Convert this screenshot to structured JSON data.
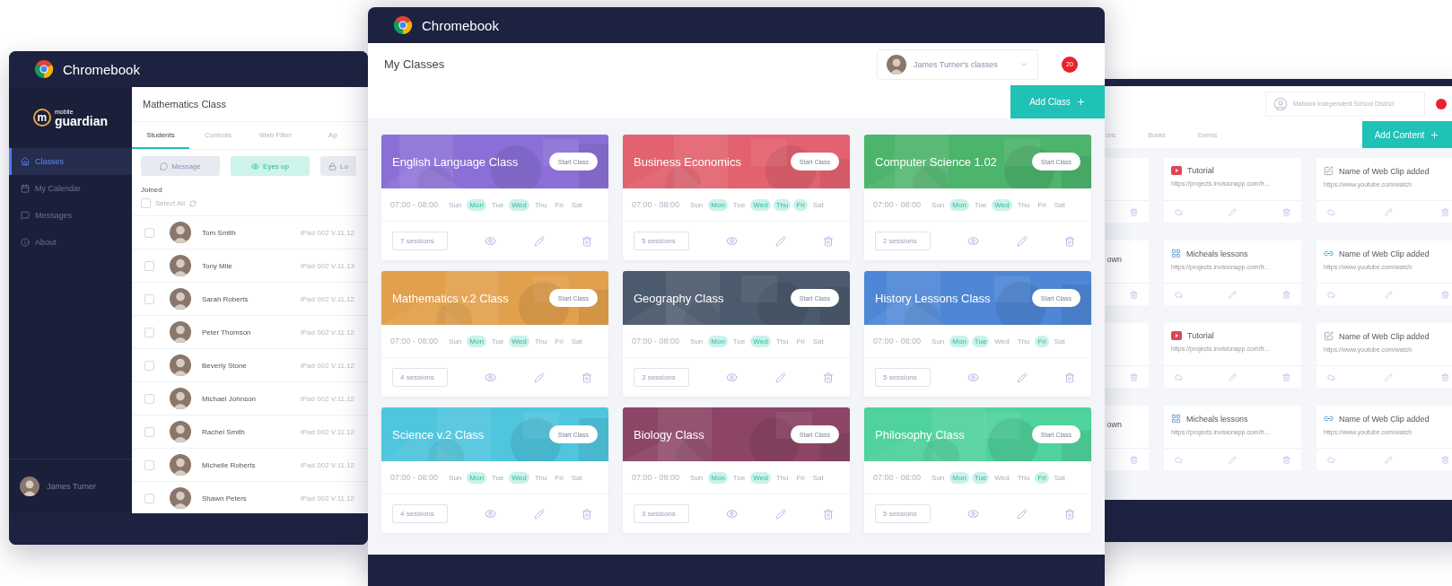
{
  "left_window": {
    "title": "Chromebook",
    "logo": {
      "mark": "m",
      "top": "mobile",
      "bottom": "guardian"
    },
    "nav": [
      {
        "label": "Classes",
        "selected": true
      },
      {
        "label": "My Calendar",
        "selected": false
      },
      {
        "label": "Messages",
        "selected": false
      },
      {
        "label": "About",
        "selected": false
      }
    ],
    "user": "James Turner",
    "heading": "Mathematics Class",
    "tabs": [
      {
        "label": "Students",
        "selected": true
      },
      {
        "label": "Controls",
        "selected": false
      },
      {
        "label": "Web Filter",
        "selected": false
      },
      {
        "label": "Ap",
        "selected": false
      }
    ],
    "actions": [
      {
        "label": "Message",
        "kind": "plain"
      },
      {
        "label": "Eyes up",
        "kind": "accent"
      },
      {
        "label": "Lo",
        "kind": "plain"
      }
    ],
    "group": "Joined",
    "select_all": {
      "label": "Select All",
      "checked": false
    },
    "students": [
      {
        "name": "Tom Smith",
        "device": "iPad 002 V.11.12",
        "checked": false
      },
      {
        "name": "Tony Mile",
        "device": "iPad 002 V.11.13",
        "checked": false
      },
      {
        "name": "Sarah Roberts",
        "device": "iPad 002 V.11.12",
        "checked": false
      },
      {
        "name": "Peter Thomson",
        "device": "iPad 002 V.11.12",
        "checked": false
      },
      {
        "name": "Beverly Stone",
        "device": "iPad 002 V.11.12",
        "checked": false
      },
      {
        "name": "Michael Johnson",
        "device": "iPad 002 V.11.12",
        "checked": false
      },
      {
        "name": "Rachel Smith",
        "device": "iPad 002 V.11.12",
        "checked": false
      },
      {
        "name": "Michelle Roberts",
        "device": "iPad 002 V.11.12",
        "checked": false
      },
      {
        "name": "Shawn Peters",
        "device": "iPad 002 V.11.12",
        "checked": false
      }
    ]
  },
  "center_window": {
    "title": "Chromebook",
    "heading": "My Classes",
    "class_picker": "James Turner's classes",
    "badge": "20",
    "add_button": "Add Class",
    "classes": [
      {
        "name": "English Language Class",
        "color": "#8b6fd6",
        "action": "Start Class",
        "time": "07:00 - 08:00",
        "sessions": "7 sessions",
        "days": [
          {
            "label": "Sun",
            "selected": false
          },
          {
            "label": "Mon",
            "selected": true
          },
          {
            "label": "Tue",
            "selected": false
          },
          {
            "label": "Wed",
            "selected": true
          },
          {
            "label": "Thu",
            "selected": false
          },
          {
            "label": "Fri",
            "selected": false
          },
          {
            "label": "Sat",
            "selected": false
          }
        ]
      },
      {
        "name": "Business Economics",
        "color": "#e2626f",
        "action": "Start Class",
        "time": "07:00 - 08:00",
        "sessions": "5 sessions",
        "days": [
          {
            "label": "Sun",
            "selected": false
          },
          {
            "label": "Mon",
            "selected": true
          },
          {
            "label": "Tue",
            "selected": false
          },
          {
            "label": "Wed",
            "selected": true
          },
          {
            "label": "Thu",
            "selected": true
          },
          {
            "label": "Fri",
            "selected": true
          },
          {
            "label": "Sat",
            "selected": false
          }
        ]
      },
      {
        "name": "Computer Science 1.02",
        "color": "#4db46c",
        "action": "Start Class",
        "time": "07:00 - 08:00",
        "sessions": "2 sessions",
        "days": [
          {
            "label": "Sun",
            "selected": false
          },
          {
            "label": "Mon",
            "selected": true
          },
          {
            "label": "Tue",
            "selected": false
          },
          {
            "label": "Wed",
            "selected": true
          },
          {
            "label": "Thu",
            "selected": false
          },
          {
            "label": "Fri",
            "selected": false
          },
          {
            "label": "Sat",
            "selected": false
          }
        ]
      },
      {
        "name": "Mathematics v.2 Class",
        "color": "#e3a04c",
        "action": "Start Class",
        "time": "07:00 - 08:00",
        "sessions": "4 sessions",
        "days": [
          {
            "label": "Sun",
            "selected": false
          },
          {
            "label": "Mon",
            "selected": true
          },
          {
            "label": "Tue",
            "selected": false
          },
          {
            "label": "Wed",
            "selected": true
          },
          {
            "label": "Thu",
            "selected": false
          },
          {
            "label": "Fri",
            "selected": false
          },
          {
            "label": "Sat",
            "selected": false
          }
        ]
      },
      {
        "name": "Geography Class",
        "color": "#4b5a6d",
        "action": "Start Class",
        "time": "07:00 - 08:00",
        "sessions": "3 sessions",
        "days": [
          {
            "label": "Sun",
            "selected": false
          },
          {
            "label": "Mon",
            "selected": true
          },
          {
            "label": "Tue",
            "selected": false
          },
          {
            "label": "Wed",
            "selected": true
          },
          {
            "label": "Thu",
            "selected": false
          },
          {
            "label": "Fri",
            "selected": false
          },
          {
            "label": "Sat",
            "selected": false
          }
        ]
      },
      {
        "name": "History Lessons Class",
        "color": "#4f87d6",
        "action": "Start Class",
        "time": "07:00 - 08:00",
        "sessions": "5 sessions",
        "days": [
          {
            "label": "Sun",
            "selected": false
          },
          {
            "label": "Mon",
            "selected": true
          },
          {
            "label": "Tue",
            "selected": true
          },
          {
            "label": "Wed",
            "selected": false
          },
          {
            "label": "Thu",
            "selected": false
          },
          {
            "label": "Fri",
            "selected": true
          },
          {
            "label": "Sat",
            "selected": false
          }
        ]
      },
      {
        "name": "Science v.2 Class",
        "color": "#4fc5de",
        "action": "Start Class",
        "time": "07:00 - 08:00",
        "sessions": "4 sessions",
        "days": [
          {
            "label": "Sun",
            "selected": false
          },
          {
            "label": "Mon",
            "selected": true
          },
          {
            "label": "Tue",
            "selected": false
          },
          {
            "label": "Wed",
            "selected": true
          },
          {
            "label": "Thu",
            "selected": false
          },
          {
            "label": "Fri",
            "selected": false
          },
          {
            "label": "Sat",
            "selected": false
          }
        ]
      },
      {
        "name": "Biology Class",
        "color": "#8c4567",
        "action": "Start Class",
        "time": "07:00 - 08:00",
        "sessions": "3 sessions",
        "days": [
          {
            "label": "Sun",
            "selected": false
          },
          {
            "label": "Mon",
            "selected": true
          },
          {
            "label": "Tue",
            "selected": false
          },
          {
            "label": "Wed",
            "selected": true
          },
          {
            "label": "Thu",
            "selected": false
          },
          {
            "label": "Fri",
            "selected": false
          },
          {
            "label": "Sat",
            "selected": false
          }
        ]
      },
      {
        "name": "Philosophy Class",
        "color": "#4fd29b",
        "action": "Start Class",
        "time": "07:00 - 08:00",
        "sessions": "5 sessions",
        "days": [
          {
            "label": "Sun",
            "selected": false
          },
          {
            "label": "Mon",
            "selected": true
          },
          {
            "label": "Tue",
            "selected": true
          },
          {
            "label": "Wed",
            "selected": false
          },
          {
            "label": "Thu",
            "selected": false
          },
          {
            "label": "Fri",
            "selected": true
          },
          {
            "label": "Sat",
            "selected": false
          }
        ]
      }
    ]
  },
  "right_window": {
    "picker": "Mabank Independent School District",
    "tabs": [
      {
        "label": "ons",
        "selected": false
      },
      {
        "label": "Books",
        "selected": false
      },
      {
        "label": "Events",
        "selected": false
      }
    ],
    "add_button": "Add Content",
    "rows": [
      {
        "cards": [
          {
            "kind": "video",
            "title": "Tutorial",
            "url": "https://projects.invisionapp.com/fr..."
          },
          {
            "kind": "webclip",
            "title": "Name of Web Clip added",
            "url": "https://www.youtube.com/watch"
          }
        ]
      },
      {
        "cut_text": "own",
        "cards": [
          {
            "kind": "document",
            "title": "Micheals lessons",
            "url": "https://projects.invisionapp.com/fr..."
          },
          {
            "kind": "link",
            "title": "Name of Web Clip added",
            "url": "https://www.youtube.com/watch"
          }
        ]
      },
      {
        "cards": [
          {
            "kind": "video",
            "title": "Tutorial",
            "url": "https://projects.invisionapp.com/fr..."
          },
          {
            "kind": "webclip",
            "title": "Name of Web Clip added",
            "url": "https://www.youtube.com/watch"
          }
        ]
      },
      {
        "cut_text": "own",
        "cards": [
          {
            "kind": "document",
            "title": "Micheals lessons",
            "url": "https://projects.invisionapp.com/fr..."
          },
          {
            "kind": "link",
            "title": "Name of Web Clip added",
            "url": "https://www.youtube.com/watch"
          }
        ]
      }
    ]
  }
}
